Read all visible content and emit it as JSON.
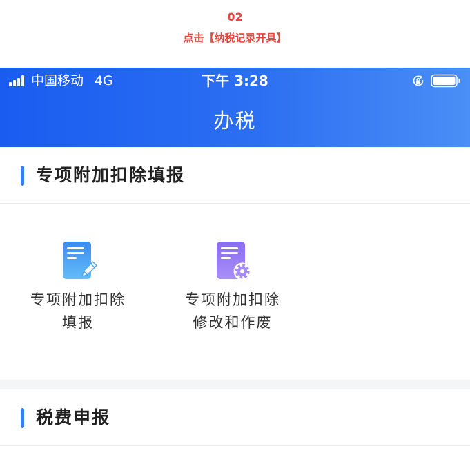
{
  "caption": {
    "step": "02",
    "instruction": "点击【纳税记录开具】"
  },
  "status_bar": {
    "carrier": "中国移动",
    "network": "4G",
    "time": "下午 3:28",
    "icons": [
      "signal-bars-icon",
      "rotation-lock-icon",
      "battery-icon"
    ]
  },
  "header": {
    "title": "办税"
  },
  "sections": [
    {
      "title": "专项附加扣除填报",
      "items": [
        {
          "line1": "专项附加扣除",
          "line2": "填报",
          "icon": "document-edit-icon"
        },
        {
          "line1": "专项附加扣除",
          "line2": "修改和作废",
          "icon": "document-settings-icon"
        }
      ]
    },
    {
      "title": "税费申报"
    }
  ],
  "colors": {
    "caption_red": "#e8453c",
    "header_start": "#1a5cf0",
    "header_end": "#4a8ef6",
    "accent_bar": "#3b7cf1",
    "icon_blue": "#4aa6f5",
    "icon_purple": "#9b7ff5",
    "band_gray": "#f4f5f7"
  }
}
